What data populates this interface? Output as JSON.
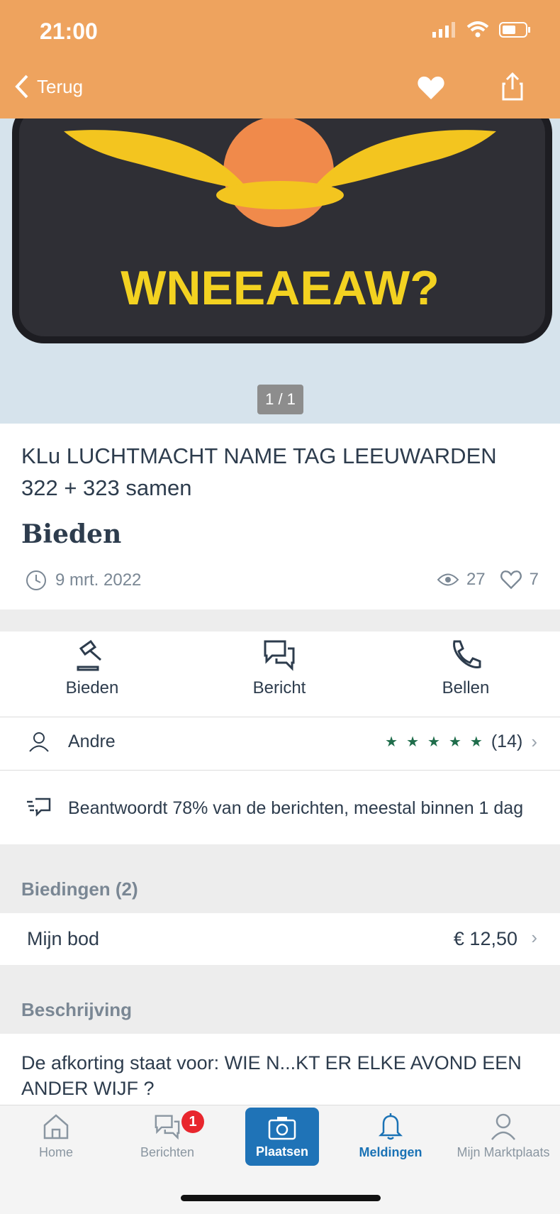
{
  "status_bar": {
    "time": "21:00"
  },
  "nav": {
    "back_label": "Terug"
  },
  "photo": {
    "patch_text": "WNEEAEAW?",
    "counter": "1 / 1"
  },
  "listing": {
    "title": "KLu LUCHTMACHT NAME TAG LEEUWARDEN 322 + 323 samen",
    "price_label": "Bieden",
    "date": "9 mrt. 2022",
    "views": "27",
    "favorites": "7"
  },
  "actions": {
    "bid": "Bieden",
    "message": "Bericht",
    "call": "Bellen"
  },
  "seller": {
    "name": "Andre",
    "rating_count": "(14)",
    "response_text": "Beantwoordt 78% van de berichten, meestal binnen 1 dag"
  },
  "bids": {
    "section_label": "Biedingen (2)",
    "my_bid_label": "Mijn bod",
    "my_bid_value": "€ 12,50"
  },
  "description": {
    "section_label": "Beschrijving",
    "text": "De afkorting staat voor:  WIE   N...KT  ER ELKE AVOND EEN ANDER WIJF ?"
  },
  "tabbar": {
    "home": "Home",
    "messages": "Berichten",
    "messages_badge": "1",
    "post": "Plaatsen",
    "notifications": "Meldingen",
    "my_account": "Mijn Marktplaats"
  },
  "colors": {
    "header": "#eea35e",
    "accent": "#1f73b7",
    "stars": "#1f6d4b",
    "badge": "#e8262d"
  }
}
